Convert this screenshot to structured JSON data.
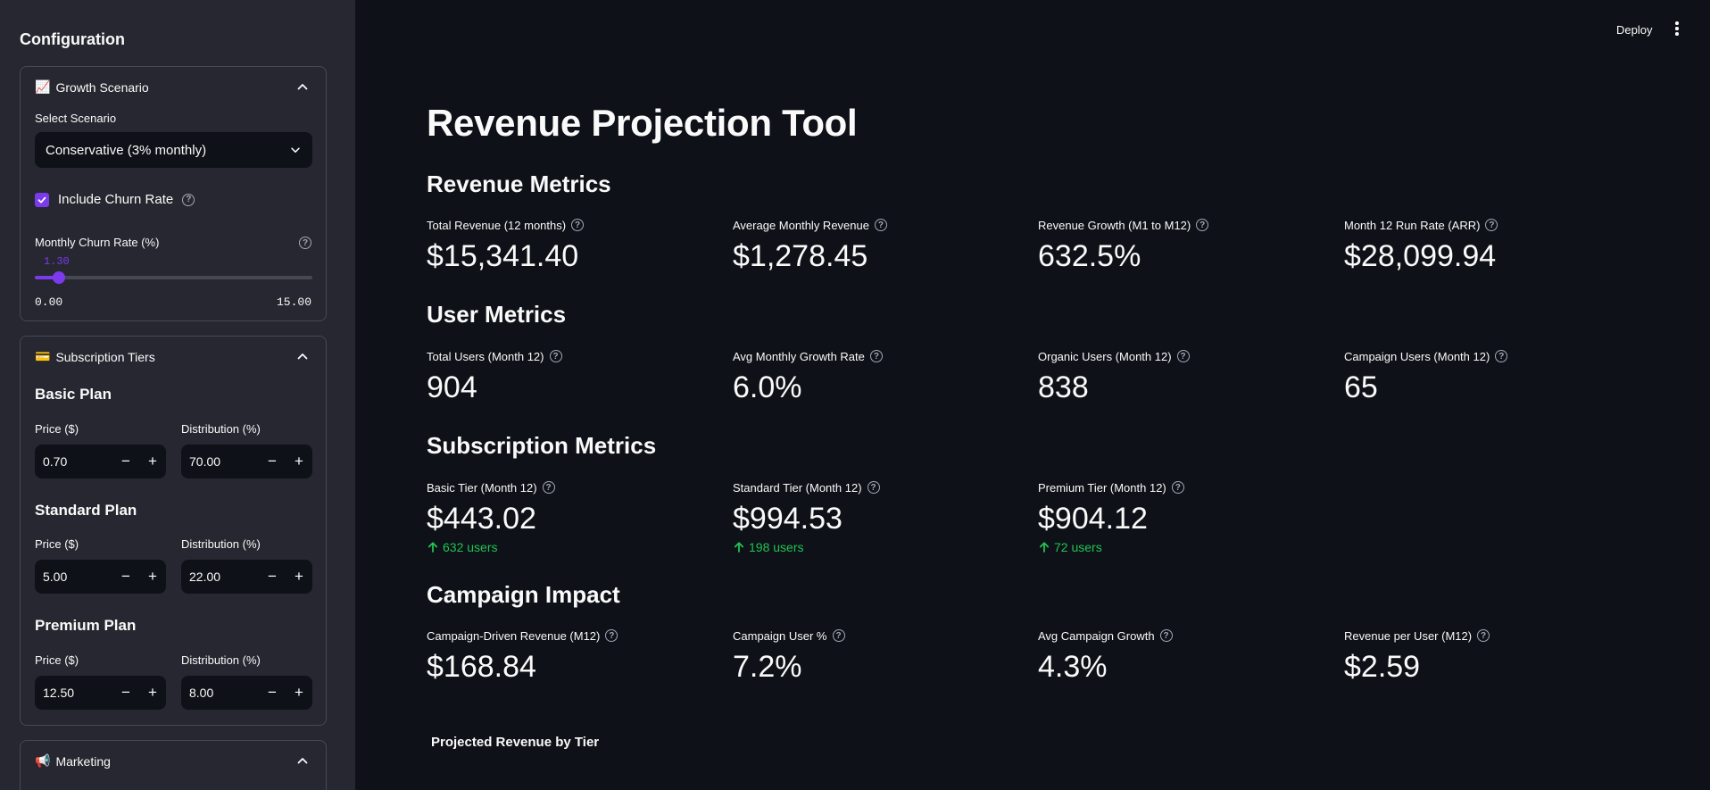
{
  "sidebar": {
    "title": "Configuration",
    "growth": {
      "header": "Growth Scenario",
      "header_icon": "chart-increasing-icon",
      "select_label": "Select Scenario",
      "select_value": "Conservative (3% monthly)",
      "churn_checkbox_label": "Include Churn Rate",
      "churn_checked": true,
      "churn_rate_label": "Monthly Churn Rate (%)",
      "churn_rate_value": "1.30",
      "churn_rate_min": "0.00",
      "churn_rate_max": "15.00",
      "churn_rate_number": 1.3,
      "churn_rate_range": [
        0,
        15
      ]
    },
    "tiers": {
      "header": "Subscription Tiers",
      "header_icon": "credit-card-icon",
      "price_label": "Price ($)",
      "distribution_label": "Distribution (%)",
      "basic": {
        "title": "Basic Plan",
        "price": "0.70",
        "distribution": "70.00"
      },
      "standard": {
        "title": "Standard Plan",
        "price": "5.00",
        "distribution": "22.00"
      },
      "premium": {
        "title": "Premium Plan",
        "price": "12.50",
        "distribution": "8.00"
      }
    },
    "marketing": {
      "header": "Marketing",
      "header_icon": "megaphone-icon"
    }
  },
  "toolbar": {
    "deploy_label": "Deploy"
  },
  "main": {
    "title": "Revenue Projection Tool",
    "sections": {
      "revenue": {
        "title": "Revenue Metrics",
        "metrics": [
          {
            "label": "Total Revenue (12 months)",
            "value": "$15,341.40"
          },
          {
            "label": "Average Monthly Revenue",
            "value": "$1,278.45"
          },
          {
            "label": "Revenue Growth (M1 to M12)",
            "value": "632.5%"
          },
          {
            "label": "Month 12 Run Rate (ARR)",
            "value": "$28,099.94"
          }
        ]
      },
      "users": {
        "title": "User Metrics",
        "metrics": [
          {
            "label": "Total Users (Month 12)",
            "value": "904"
          },
          {
            "label": "Avg Monthly Growth Rate",
            "value": "6.0%"
          },
          {
            "label": "Organic Users (Month 12)",
            "value": "838"
          },
          {
            "label": "Campaign Users (Month 12)",
            "value": "65"
          }
        ]
      },
      "subscription": {
        "title": "Subscription Metrics",
        "metrics": [
          {
            "label": "Basic Tier (Month 12)",
            "value": "$443.02",
            "delta": "632 users"
          },
          {
            "label": "Standard Tier (Month 12)",
            "value": "$994.53",
            "delta": "198 users"
          },
          {
            "label": "Premium Tier (Month 12)",
            "value": "$904.12",
            "delta": "72 users"
          }
        ]
      },
      "campaign": {
        "title": "Campaign Impact",
        "metrics": [
          {
            "label": "Campaign-Driven Revenue (M12)",
            "value": "$168.84"
          },
          {
            "label": "Campaign User %",
            "value": "7.2%"
          },
          {
            "label": "Avg Campaign Growth",
            "value": "4.3%"
          },
          {
            "label": "Revenue per User (M12)",
            "value": "$2.59"
          }
        ]
      }
    },
    "chart_title": "Projected Revenue by Tier"
  },
  "colors": {
    "accent": "#7c3aed",
    "positive": "#21c354",
    "background": "#0e1117",
    "sidebar": "#262730"
  }
}
